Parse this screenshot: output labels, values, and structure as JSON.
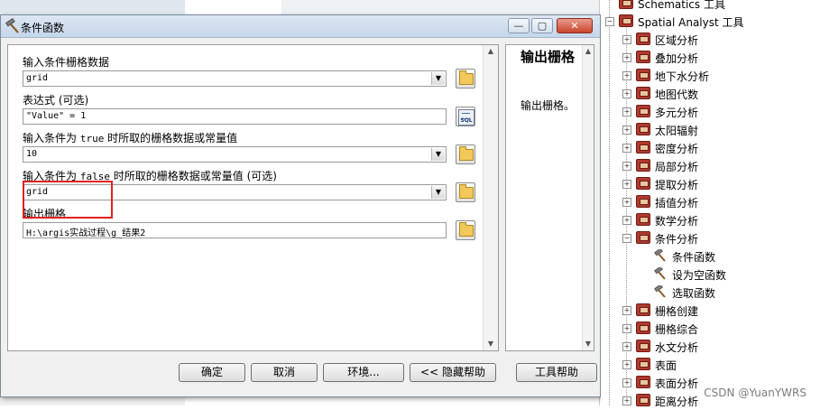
{
  "dialog": {
    "title": "条件函数",
    "fields": [
      {
        "label": "输入条件栅格数据",
        "value": "grid"
      },
      {
        "label": "表达式 (可选)",
        "value": "\"Value\" = 1"
      },
      {
        "label_before": "输入条件为 ",
        "label_keyword": "true",
        "label_after": " 时所取的栅格数据或常量值",
        "value": "10"
      },
      {
        "label_before": "输入条件为 ",
        "label_keyword": "false",
        "label_after": " 时所取的栅格数据或常量值 (可选)",
        "value": "grid"
      },
      {
        "label": "输出栅格",
        "value": "H:\\argis实战过程\\g_结果2"
      }
    ],
    "sql_label": "SQL",
    "help": {
      "title": "输出栅格",
      "body": "输出栅格。"
    },
    "buttons": {
      "ok": "确定",
      "cancel": "取消",
      "env": "环境...",
      "hide_help": "<< 隐藏帮助",
      "tool_help": "工具帮助"
    },
    "window_buttons": {
      "min": "—",
      "max": "▢",
      "close": "✕"
    }
  },
  "tree": {
    "top_partial": "Schematics 工具",
    "root": "Spatial Analyst 工具",
    "items": [
      "区域分析",
      "叠加分析",
      "地下水分析",
      "地图代数",
      "多元分析",
      "太阳辐射",
      "密度分析",
      "局部分析",
      "提取分析",
      "插值分析",
      "数学分析"
    ],
    "expanded": "条件分析",
    "children": [
      "条件函数",
      "设为空函数",
      "选取函数"
    ],
    "items_after": [
      "栅格创建",
      "栅格综合",
      "水文分析",
      "表面",
      "表面分析",
      "距离分析"
    ]
  },
  "watermark": "CSDN @YuanYWRS",
  "colors": {
    "highlight_box": "#e02020",
    "toolbox_red": "#b03a2e",
    "title_gradient": "#c6d6ea"
  }
}
